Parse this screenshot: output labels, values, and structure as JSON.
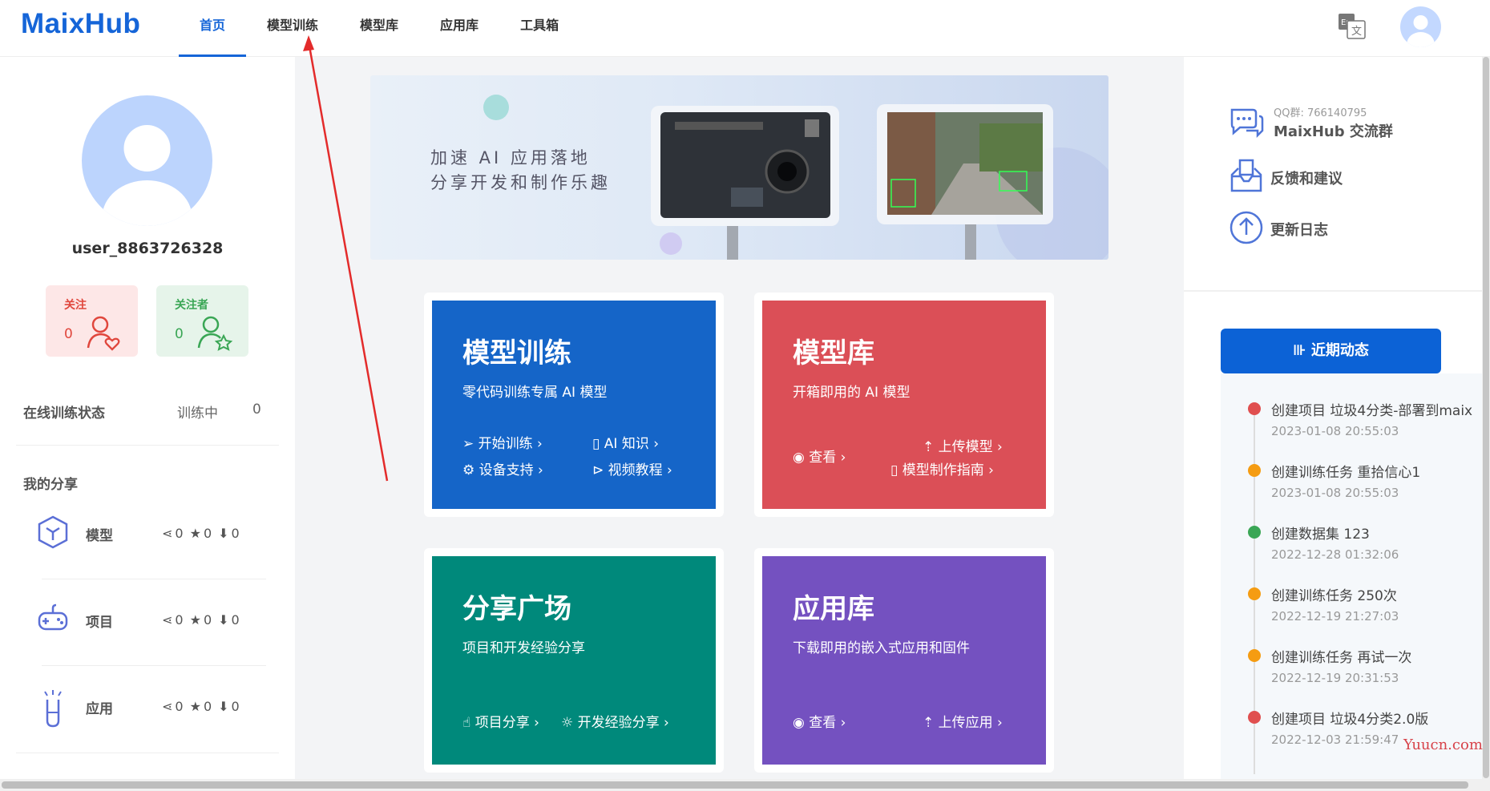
{
  "header": {
    "logo": "MaixHub",
    "nav": [
      {
        "label": "首页",
        "active": true
      },
      {
        "label": "模型训练",
        "active": false
      },
      {
        "label": "模型库",
        "active": false
      },
      {
        "label": "应用库",
        "active": false
      },
      {
        "label": "工具箱",
        "active": false
      }
    ],
    "lang_icon": "translate-icon",
    "avatar_icon": "user-avatar-icon"
  },
  "profile": {
    "username": "user_8863726328",
    "following": {
      "label": "关注",
      "count": "0"
    },
    "followers": {
      "label": "关注者",
      "count": "0"
    },
    "train_status": {
      "label": "在线训练状态",
      "state": "训练中",
      "count": "0"
    },
    "my_share": {
      "title": "我的分享",
      "rows": [
        {
          "name": "模型",
          "share": "0",
          "star": "0",
          "download": "0"
        },
        {
          "name": "项目",
          "share": "0",
          "star": "0",
          "download": "0"
        },
        {
          "name": "应用",
          "share": "0",
          "star": "0",
          "download": "0"
        }
      ]
    }
  },
  "banner": {
    "line1": "加速 AI 应用落地",
    "line2": "分享开发和制作乐趣"
  },
  "cards": {
    "training": {
      "title": "模型训练",
      "subtitle": "零代码训练专属 AI 模型",
      "links": [
        "开始训练",
        "AI 知识",
        "设备支持",
        "视频教程"
      ],
      "color": "#1565c8"
    },
    "model_lib": {
      "title": "模型库",
      "subtitle": "开箱即用的 AI 模型",
      "links": [
        "查看",
        "上传模型",
        "模型制作指南"
      ],
      "color": "#db4f57"
    },
    "share": {
      "title": "分享广场",
      "subtitle": "项目和开发经验分享",
      "links": [
        "项目分享",
        "开发经验分享"
      ],
      "color": "#00897b"
    },
    "app_lib": {
      "title": "应用库",
      "subtitle": "下载即用的嵌入式应用和固件",
      "links": [
        "查看",
        "上传应用"
      ],
      "color": "#7451c0"
    }
  },
  "sidebar_right": {
    "qq": "QQ群: 766140795",
    "group": "MaixHub 交流群",
    "feedback": "反馈和建议",
    "changelog": "更新日志",
    "activity_title": "近期动态",
    "activities": [
      {
        "title": "创建项目 垃圾4分类-部署到maix",
        "time": "2023-01-08 20:55:03",
        "color": "#e04f4f"
      },
      {
        "title": "创建训练任务 重拾信心1",
        "time": "2023-01-08 20:55:03",
        "color": "#f59c12"
      },
      {
        "title": "创建数据集 123",
        "time": "2022-12-28 01:32:06",
        "color": "#3aa655"
      },
      {
        "title": "创建训练任务 250次",
        "time": "2022-12-19 21:27:03",
        "color": "#f59c12"
      },
      {
        "title": "创建训练任务 再试一次",
        "time": "2022-12-19 20:31:53",
        "color": "#f59c12"
      },
      {
        "title": "创建项目 垃圾4分类2.0版",
        "time": "2022-12-03 21:59:47",
        "color": "#e04f4f"
      }
    ]
  },
  "watermark": "Yuucn.com"
}
